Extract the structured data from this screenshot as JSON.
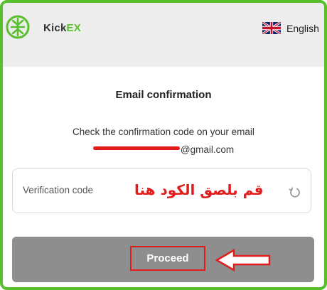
{
  "header": {
    "brand_prefix": "Kick",
    "brand_suffix": "EX",
    "language": "English",
    "language_flag_icon": "uk-flag-icon"
  },
  "main": {
    "title": "Email confirmation",
    "description": "Check the confirmation code on your email",
    "email_domain": "@gmail.com",
    "verification_placeholder": "Verification code",
    "annotation_arabic": "قم بلصق الكود هنا",
    "refresh_icon": "refresh-icon",
    "proceed_label": "Proceed",
    "annotation_arrow_icon": "left-arrow-icon"
  },
  "colors": {
    "accent": "#59c02d",
    "annotation": "#e21b1b",
    "proceed_bar": "#8e8e8e",
    "header_bg": "#ededed"
  }
}
